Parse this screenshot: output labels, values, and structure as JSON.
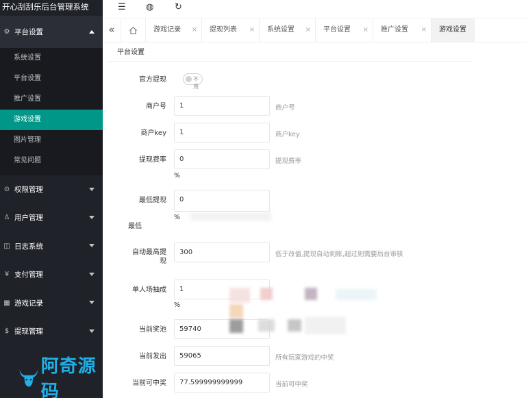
{
  "app": {
    "title": "开心刮刮乐后台管理系统"
  },
  "sidebar": {
    "groups": [
      {
        "label": "平台设置",
        "icon": "gear-icon",
        "expanded": true,
        "items": [
          "系统设置",
          "平台设置",
          "推广设置",
          "游戏设置",
          "图片管理",
          "常见问题"
        ],
        "active_item": "游戏设置"
      },
      {
        "label": "权限管理",
        "icon": "shield-icon"
      },
      {
        "label": "用户管理",
        "icon": "user-icon"
      },
      {
        "label": "日志系统",
        "icon": "log-icon"
      },
      {
        "label": "支付管理",
        "icon": "yen-icon"
      },
      {
        "label": "游戏记录",
        "icon": "grid-icon"
      },
      {
        "label": "提现管理",
        "icon": "dollar-icon"
      }
    ]
  },
  "watermark": {
    "text": "阿奇源码"
  },
  "toolbar": {
    "icons": [
      "menu-icon",
      "globe-icon",
      "refresh-icon"
    ]
  },
  "tabs": {
    "items": [
      "游戏记录",
      "提现列表",
      "系统设置",
      "平台设置",
      "推广设置",
      "游戏设置"
    ],
    "active": "游戏设置",
    "close_glyph": "×"
  },
  "panel": {
    "title": "平台设置"
  },
  "form": {
    "official_withdraw": {
      "label": "官方提现",
      "switch_text": "不用",
      "on": false
    },
    "merchant_no": {
      "label": "商户号",
      "value": "1",
      "hint": "商户号"
    },
    "merchant_key": {
      "label": "商户key",
      "value": "1",
      "hint": "商户key"
    },
    "withdraw_fee": {
      "label": "提现费率",
      "value": "0",
      "hint": "提现费率",
      "unit": "%"
    },
    "min_withdraw": {
      "label": "最低提现",
      "value": "0",
      "unit": "%",
      "extra_label": "最低"
    },
    "auto_max_withdraw": {
      "label_line1": "自动最高提",
      "label_line2": "现",
      "value": "300",
      "hint": "低于改值,提现自动到账,超过则需要后台审核"
    },
    "single_draw": {
      "label": "单人场抽成",
      "value": "1",
      "unit": "%"
    },
    "current_pool": {
      "label": "当前奖池",
      "value": "59740"
    },
    "current_payout": {
      "label": "当前发出",
      "value": "59065",
      "hint": "所有玩家游戏的中奖"
    },
    "current_winnable": {
      "label": "当前可中奖",
      "value": "77.599999999999",
      "hint": "当前可中奖"
    }
  },
  "colors": {
    "sidebar_bg": "#20222a",
    "active_green": "#009688",
    "watermark_blue": "#1fb0e8"
  }
}
